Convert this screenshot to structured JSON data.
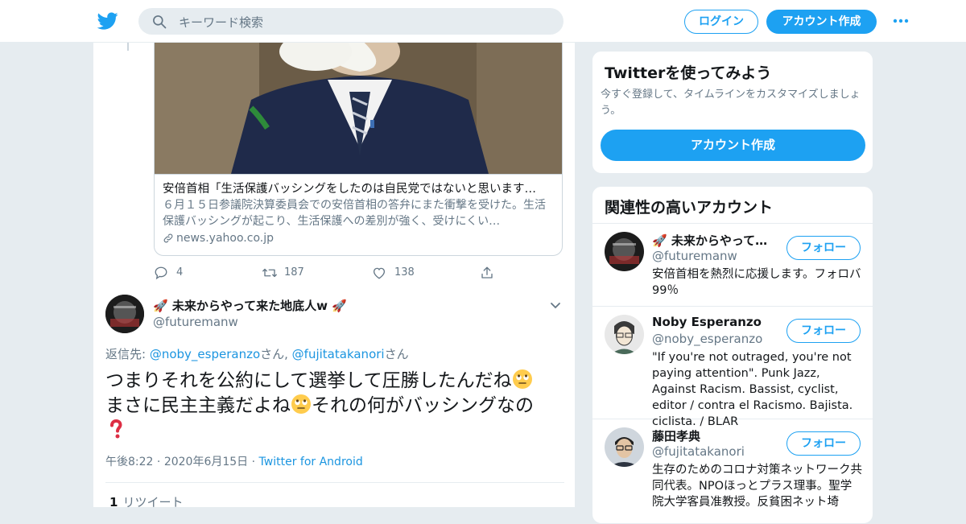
{
  "header": {
    "search_placeholder": "キーワード検索",
    "login_label": "ログイン",
    "signup_label": "アカウント作成",
    "brand_color": "#1da1f2"
  },
  "link_card": {
    "title": "安倍首相「生活保護バッシングをしたのは自民党ではないと思います…",
    "description": "６月１５日参議院決算委員会での安倍首相の答弁にまた衝撃を受けた。生活保護バッシングが起こり、生活保護への差別が強く、受けにくい…",
    "domain": "news.yahoo.co.jp"
  },
  "parent_actions": {
    "replies": "4",
    "retweets": "187",
    "likes": "138"
  },
  "tweet": {
    "display_name": "🚀 未来からやって来た地底人w 🚀",
    "handle": "@futuremanw",
    "reply_prefix": "返信先: ",
    "reply_user1": "@noby_esperanzo",
    "reply_san1": "さん, ",
    "reply_user2": "@fujitatakanori",
    "reply_san2": "さん",
    "text_part1": "つまりそれを公約にして選挙して圧勝したんだね",
    "text_part2": "まさに民主主義だよね",
    "text_part3": "それの何がバッシングなの",
    "time": "午後8:22",
    "date": "2020年6月15日",
    "source": "Twitter for Android",
    "retweet_count": "1",
    "retweet_label": "リツイート"
  },
  "try_twitter": {
    "title": "Twitterを使ってみよう",
    "description": "今すぐ登録して、タイムラインをカスタマイズしましょう。",
    "cta_label": "アカウント作成"
  },
  "related": {
    "title": "関連性の高いアカウント",
    "follow_label": "フォロー",
    "accounts": [
      {
        "name": "🚀 未来からやって…",
        "handle": "@futuremanw",
        "bio": "安倍首相を熱烈に応援します。フォロバ99％"
      },
      {
        "name": "Noby Esperanzo",
        "handle": "@noby_esperanzo",
        "bio": "\"If you're not outraged, you're not paying attention\". Punk Jazz, Against Racism. Bassist, cyclist, editor / contra el Racismo. Bajista. ciclista. / BLAR"
      },
      {
        "name": "藤田孝典",
        "handle": "@fujitatakanori",
        "bio": "生存のためのコロナ対策ネットワーク共同代表。NPOほっとプラス理事。聖学院大学客員准教授。反貧困ネット埼"
      }
    ]
  }
}
